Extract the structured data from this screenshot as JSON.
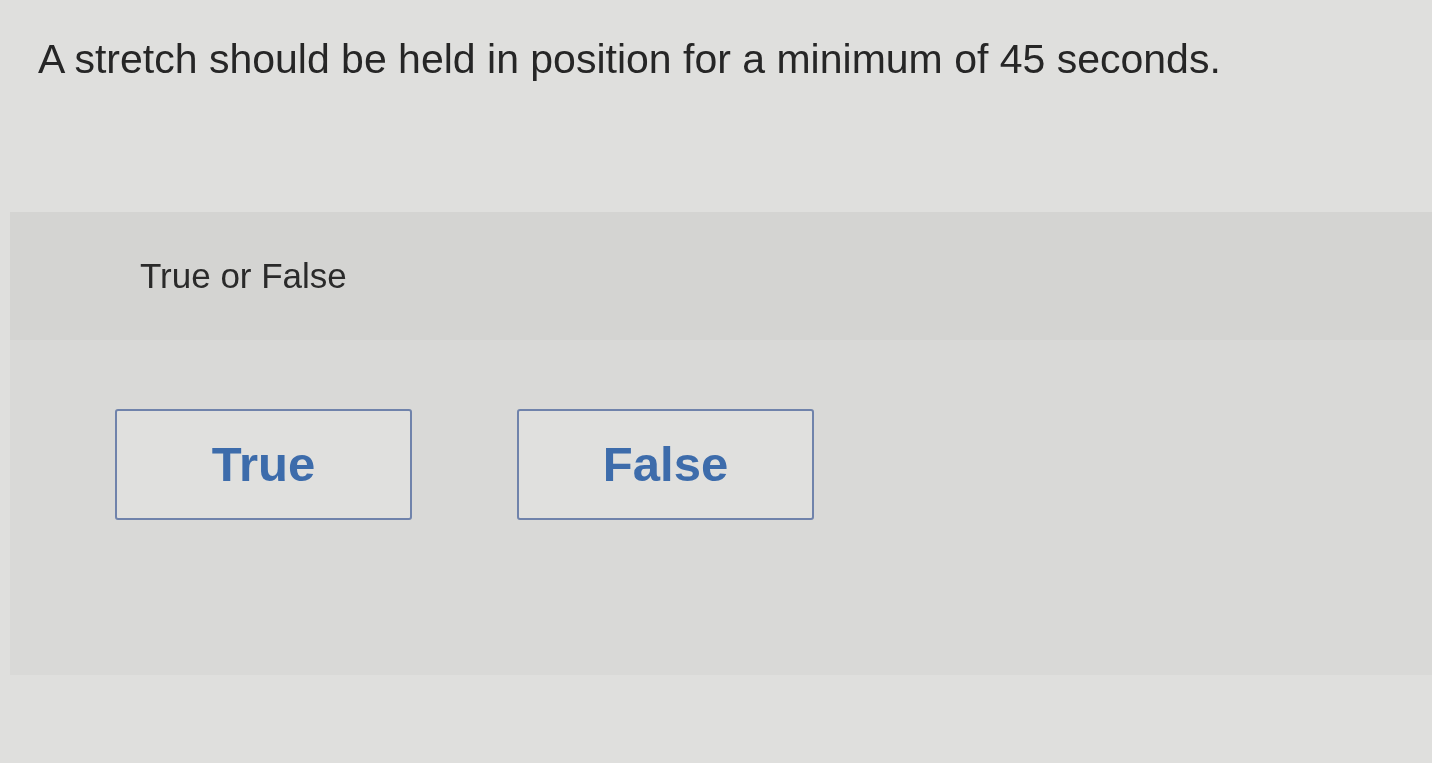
{
  "question": {
    "text": "A stretch should be held in position for a minimum of 45 seconds."
  },
  "answer_panel": {
    "prompt": "True or False",
    "options": [
      {
        "label": "True",
        "selected": false
      },
      {
        "label": "False",
        "selected": false
      }
    ]
  }
}
